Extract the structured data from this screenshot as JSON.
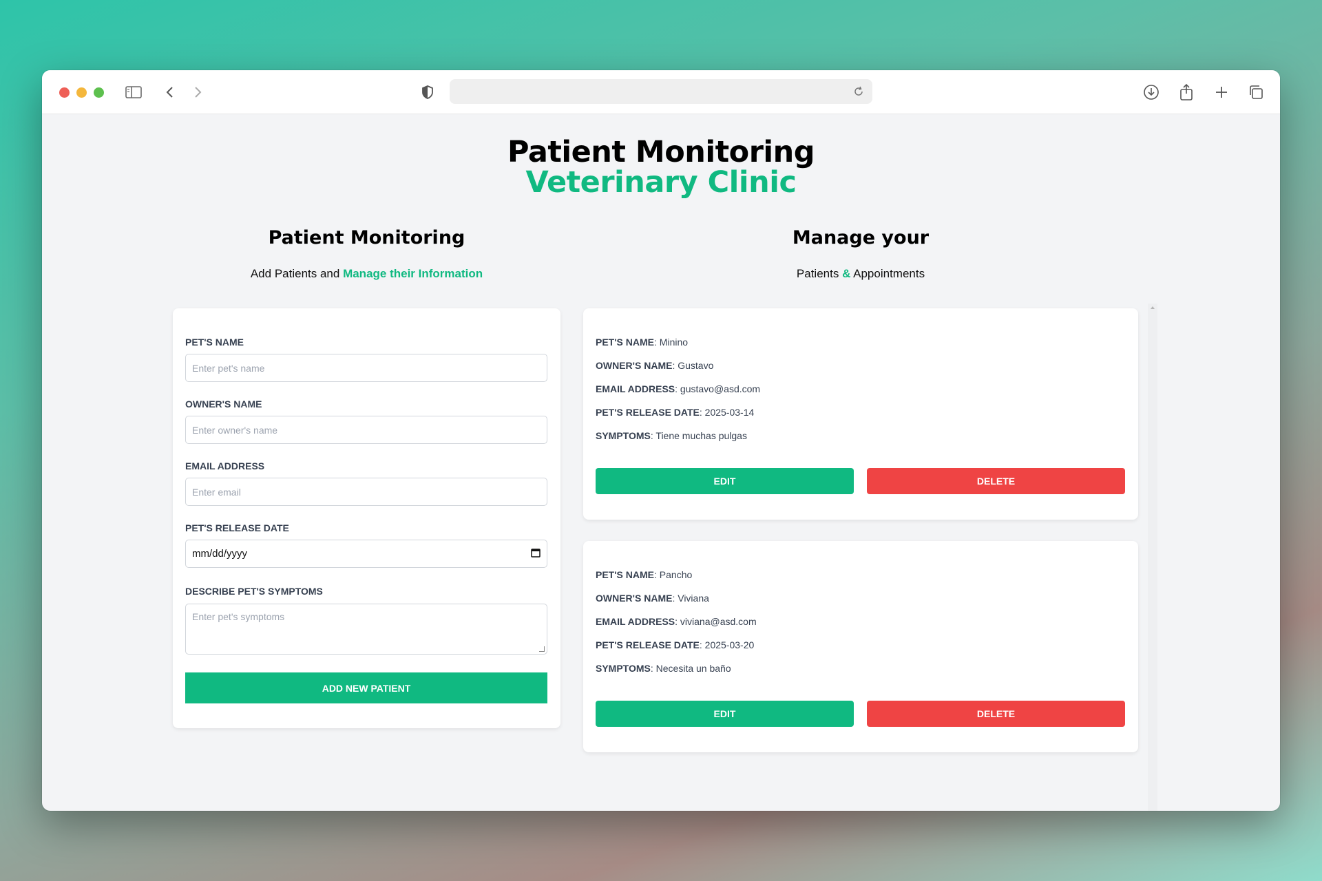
{
  "browser": {
    "url": ""
  },
  "header": {
    "title": "Patient Monitoring",
    "subtitle": "Veterinary Clinic"
  },
  "left_section": {
    "title": "Patient Monitoring",
    "subtitle_plain": "Add Patients and ",
    "subtitle_accent": "Manage their Information"
  },
  "right_section": {
    "title": "Manage your",
    "subtitle_part1": "Patients ",
    "subtitle_accent": "&",
    "subtitle_part2": " Appointments"
  },
  "form": {
    "pet_name_label": "Pet's Name",
    "pet_name_placeholder": "Enter pet's name",
    "owner_name_label": "Owner's Name",
    "owner_name_placeholder": "Enter owner's name",
    "email_label": "Email Address",
    "email_placeholder": "Enter email",
    "release_date_label": "Pet's Release Date",
    "release_date_value": "mm/dd/yyyy",
    "symptoms_label": "Describe Pet's Symptoms",
    "symptoms_placeholder": "Enter pet's symptoms",
    "submit_label": "Add New Patient"
  },
  "field_labels": {
    "pet_name": "Pet's Name",
    "owner_name": "Owner's Name",
    "email": "Email Address",
    "release_date": "Pet's Release Date",
    "symptoms": "Symptoms"
  },
  "patients": [
    {
      "pet_name": "Minino",
      "owner_name": "Gustavo",
      "email": "gustavo@asd.com",
      "release_date": "2025-03-14",
      "symptoms": "Tiene muchas pulgas",
      "edit_label": "Edit",
      "delete_label": "Delete"
    },
    {
      "pet_name": "Pancho",
      "owner_name": "Viviana",
      "email": "viviana@asd.com",
      "release_date": "2025-03-20",
      "symptoms": "Necesita un baño",
      "edit_label": "Edit",
      "delete_label": "Delete"
    }
  ],
  "colors": {
    "accent": "#10b981",
    "danger": "#ef4444",
    "page_bg": "#f3f4f6"
  }
}
